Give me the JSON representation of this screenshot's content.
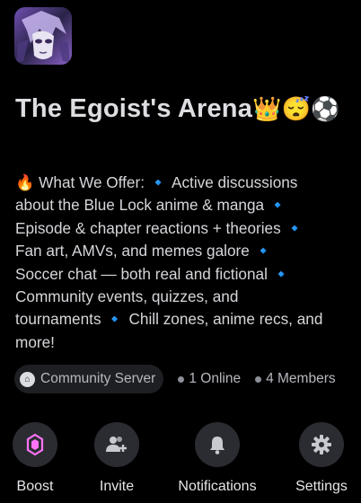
{
  "server": {
    "name": "The Egoist's Arena",
    "title_emoji": "👑😴⚽",
    "description_lines": [
      "🔥 What We Offer: 🔹 Active discussions",
      "about the Blue Lock anime & manga 🔹",
      "Episode & chapter reactions + theories 🔹",
      "Fan art, AMVs, and memes galore 🔹",
      "Soccer chat — both real and fictional 🔹",
      "Community events, quizzes, and",
      "tournaments 🔹 Chill zones, anime recs, and",
      "more!"
    ]
  },
  "meta": {
    "badge_label": "Community Server",
    "online": "1 Online",
    "members": "4 Members"
  },
  "actions": [
    {
      "label": "Boost",
      "icon": "boost-gem-icon",
      "accent": "#ff73fa"
    },
    {
      "label": "Invite",
      "icon": "add-user-icon"
    },
    {
      "label": "Notifications",
      "icon": "bell-icon"
    },
    {
      "label": "Settings",
      "icon": "gear-icon"
    }
  ],
  "colors": {
    "background": "#000000",
    "button_bg": "#2b2c31",
    "chip_bg": "#1e1f23",
    "diamond": "#5b8cf0"
  }
}
